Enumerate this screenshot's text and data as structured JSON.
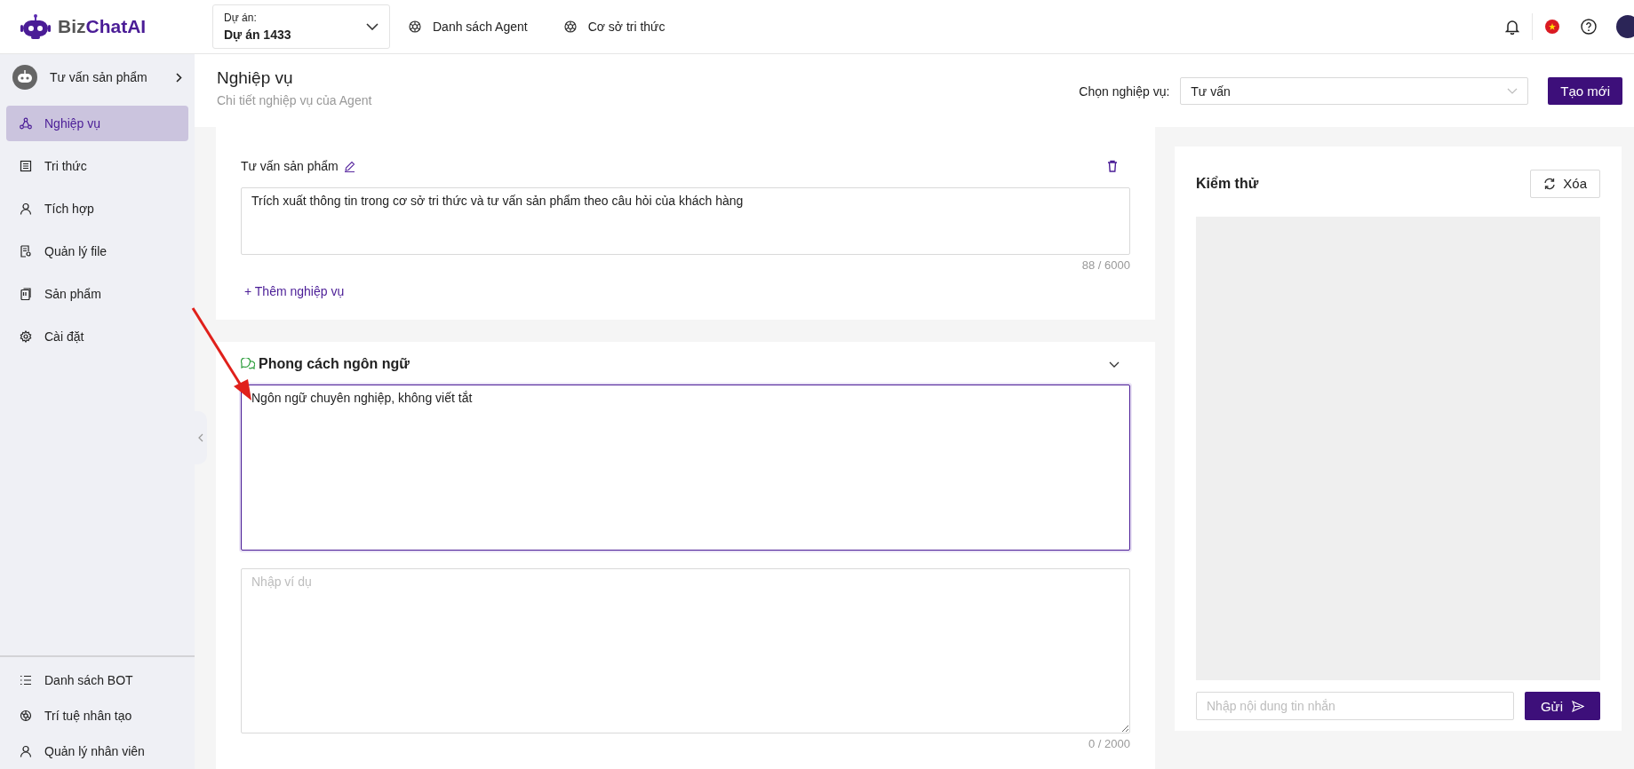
{
  "header": {
    "logo": {
      "part_1": "Biz",
      "part_2": "ChatAI"
    },
    "project_select": {
      "label": "Dự án:",
      "value": "Dự án 1433"
    },
    "nav": [
      "Danh sách Agent",
      "Cơ sở tri thức"
    ]
  },
  "sidebar": {
    "agent": "Tư vấn sản phẩm",
    "items": [
      {
        "label": "Nghiệp vụ",
        "selected": true
      },
      {
        "label": "Tri thức",
        "selected": false
      },
      {
        "label": "Tích hợp",
        "selected": false
      },
      {
        "label": "Quản lý file",
        "selected": false
      },
      {
        "label": "Sản phẩm",
        "selected": false
      },
      {
        "label": "Cài đặt",
        "selected": false
      }
    ],
    "bottom_items": [
      "Danh sách BOT",
      "Trí tuệ nhân tạo",
      "Quản lý nhân viên"
    ]
  },
  "page": {
    "title": "Nghiệp vụ",
    "subtitle": "Chi tiết nghiệp vụ của Agent",
    "picker_label": "Chọn nghiệp vụ:",
    "picker_value": "Tư vấn",
    "create_button": "Tạo mới"
  },
  "task_card": {
    "task_name": "Tư vấn sản phẩm",
    "description": "Trích xuất thông tin trong cơ sở tri thức và tư vấn sản phẩm theo câu hỏi của khách hàng",
    "counter": "88 / 6000",
    "add_link": "+ Thêm nghiệp vụ"
  },
  "style_card": {
    "title": "Phong cách ngôn ngữ",
    "expanded": true,
    "value": "Ngôn ngữ chuyên nghiệp, không viết tắt",
    "focused": true,
    "example_placeholder": "Nhập ví dụ",
    "counter": "0 / 2000"
  },
  "test_panel": {
    "title": "Kiểm thử",
    "clear_button": "Xóa",
    "message_placeholder": "Nhập nội dung tin nhắn",
    "send_button": "Gửi"
  }
}
